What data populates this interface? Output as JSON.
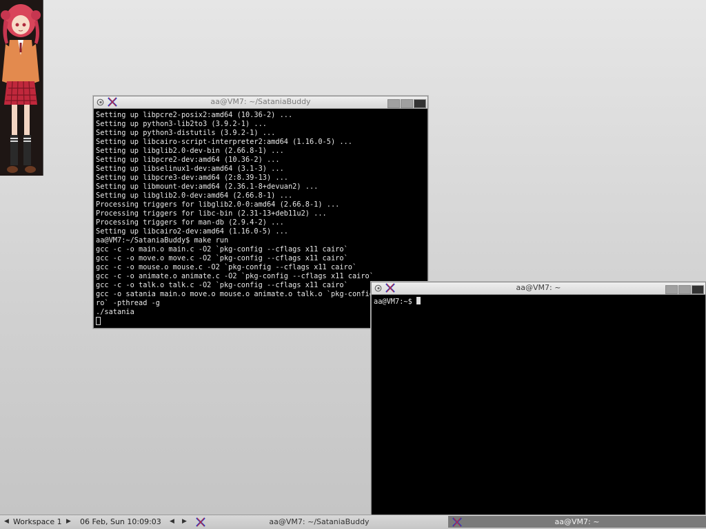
{
  "desktop": {
    "terminal1": {
      "title": "aa@VM7: ~/SataniaBuddy",
      "lines": [
        "Setting up libpcre2-posix2:amd64 (10.36-2) ...",
        "Setting up python3-lib2to3 (3.9.2-1) ...",
        "Setting up python3-distutils (3.9.2-1) ...",
        "Setting up libcairo-script-interpreter2:amd64 (1.16.0-5) ...",
        "Setting up libglib2.0-dev-bin (2.66.8-1) ...",
        "Setting up libpcre2-dev:amd64 (10.36-2) ...",
        "Setting up libselinux1-dev:amd64 (3.1-3) ...",
        "Setting up libpcre3-dev:amd64 (2:8.39-13) ...",
        "Setting up libmount-dev:amd64 (2.36.1-8+devuan2) ...",
        "Setting up libglib2.0-dev:amd64 (2.66.8-1) ...",
        "Processing triggers for libglib2.0-0:amd64 (2.66.8-1) ...",
        "Processing triggers for libc-bin (2.31-13+deb11u2) ...",
        "Processing triggers for man-db (2.9.4-2) ...",
        "Setting up libcairo2-dev:amd64 (1.16.0-5) ...",
        "aa@VM7:~/SataniaBuddy$ make run",
        "gcc -c -o main.o main.c -O2 `pkg-config --cflags x11 cairo`",
        "gcc -c -o move.o move.c -O2 `pkg-config --cflags x11 cairo`",
        "gcc -c -o mouse.o mouse.c -O2 `pkg-config --cflags x11 cairo`",
        "gcc -c -o animate.o animate.c -O2 `pkg-config --cflags x11 cairo`",
        "gcc -c -o talk.o talk.c -O2 `pkg-config --cflags x11 cairo`",
        "gcc -o satania main.o move.o mouse.o animate.o talk.o `pkg-config --libs x11 cai",
        "ro` -pthread -g",
        "./satania"
      ]
    },
    "terminal2": {
      "title": "aa@VM7: ~",
      "prompt": "aa@VM7:~$ "
    }
  },
  "taskbar": {
    "workspace": "Workspace 1",
    "clock": "06 Feb, Sun 10:09:03",
    "tasks": [
      {
        "label": "aa@VM7: ~/SataniaBuddy",
        "active": false
      },
      {
        "label": "aa@VM7: ~",
        "active": true
      }
    ]
  },
  "icons": {
    "window_menu": "debian-swirl-icon",
    "app": "xterm-x-icon",
    "nav_left": "triangle-left-icon",
    "nav_right": "triangle-right-icon"
  },
  "colors": {
    "terminal_bg": "#000000",
    "terminal_fg": "#e8e8e8",
    "active_task_bg": "#7a7a7a"
  }
}
